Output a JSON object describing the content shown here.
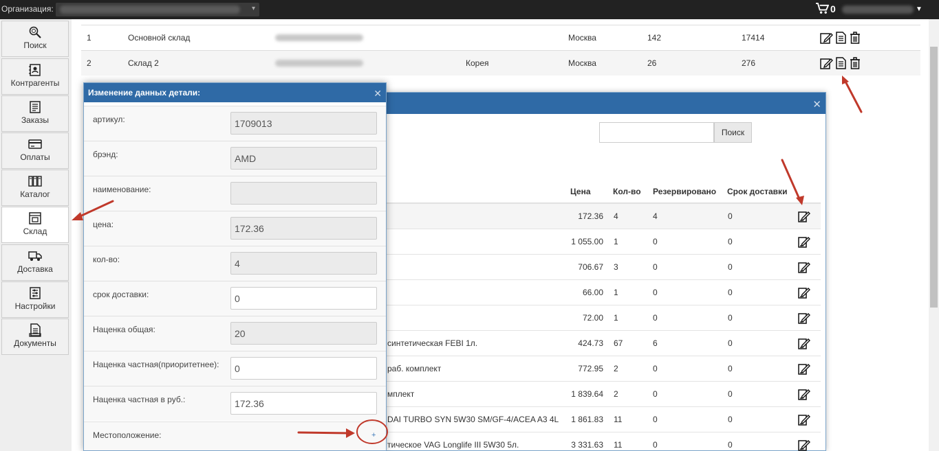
{
  "topbar": {
    "org_label": "Организация:",
    "cart_count": "0"
  },
  "sidebar": {
    "items": [
      {
        "label": "Поиск",
        "icon": "search-icon"
      },
      {
        "label": "Контрагенты",
        "icon": "contacts-icon"
      },
      {
        "label": "Заказы",
        "icon": "orders-icon"
      },
      {
        "label": "Оплаты",
        "icon": "payments-icon"
      },
      {
        "label": "Каталог",
        "icon": "catalog-icon"
      },
      {
        "label": "Склад",
        "icon": "warehouse-icon"
      },
      {
        "label": "Доставка",
        "icon": "delivery-icon"
      },
      {
        "label": "Настройки",
        "icon": "settings-icon"
      },
      {
        "label": "Документы",
        "icon": "documents-icon"
      }
    ]
  },
  "warehouses": [
    {
      "num": "1",
      "name": "Основной склад",
      "country": "",
      "city": "Москва",
      "count": "142",
      "total": "17414"
    },
    {
      "num": "2",
      "name": "Склад 2",
      "country": "Корея",
      "city": "Москва",
      "count": "26",
      "total": "276"
    }
  ],
  "back_modal": {
    "search_button": "Поиск",
    "headers": {
      "price": "Цена",
      "qty": "Кол-во",
      "reserved": "Резервировано",
      "delivery": "Срок доставки"
    },
    "rows": [
      {
        "name": "",
        "price": "172.36",
        "qty": "4",
        "reserved": "4",
        "delivery": "0"
      },
      {
        "name": "",
        "price": "1 055.00",
        "qty": "1",
        "reserved": "0",
        "delivery": "0"
      },
      {
        "name": "",
        "price": "706.67",
        "qty": "3",
        "reserved": "0",
        "delivery": "0"
      },
      {
        "name": "",
        "price": "66.00",
        "qty": "1",
        "reserved": "0",
        "delivery": "0"
      },
      {
        "name": "",
        "price": "72.00",
        "qty": "1",
        "reserved": "0",
        "delivery": "0"
      },
      {
        "name": " синтетическая FEBI 1л.",
        "price": "424.73",
        "qty": "67",
        "reserved": "6",
        "delivery": "0"
      },
      {
        "name": "раб. комплект",
        "price": "772.95",
        "qty": "2",
        "reserved": "0",
        "delivery": "0"
      },
      {
        "name": "мплект",
        "price": "1 839.64",
        "qty": "2",
        "reserved": "0",
        "delivery": "0"
      },
      {
        "name": "DAI TURBO SYN 5W30 SM/GF-4/ACEA A3 4L",
        "price": "1 861.83",
        "qty": "11",
        "reserved": "0",
        "delivery": "0"
      },
      {
        "name": "тическое VAG Longlife III 5W30 5л.",
        "price": "3 331.63",
        "qty": "11",
        "reserved": "0",
        "delivery": "0"
      }
    ]
  },
  "edit_modal": {
    "title": "Изменение данных детали:",
    "fields": [
      {
        "label": "артикул:",
        "value": "1709013",
        "readonly": true
      },
      {
        "label": "брэнд:",
        "value": "AMD",
        "readonly": true
      },
      {
        "label": "наименование:",
        "value": "",
        "readonly": true
      },
      {
        "label": "цена:",
        "value": "172.36",
        "readonly": true
      },
      {
        "label": "кол-во:",
        "value": "4",
        "readonly": true
      },
      {
        "label": "срок доставки:",
        "value": "0",
        "readonly": false
      },
      {
        "label": "Наценка общая:",
        "value": "20",
        "readonly": true
      },
      {
        "label": "Наценка частная(приоритетнее):",
        "value": "0",
        "readonly": false
      },
      {
        "label": "Наценка частная в руб.:",
        "value": "172.36",
        "readonly": false
      }
    ],
    "location_label": "Местоположение:",
    "add_location": "+"
  },
  "colors": {
    "header_blue": "#2f6aa6",
    "topbar": "#222222",
    "arrow_red": "#c0392b"
  }
}
